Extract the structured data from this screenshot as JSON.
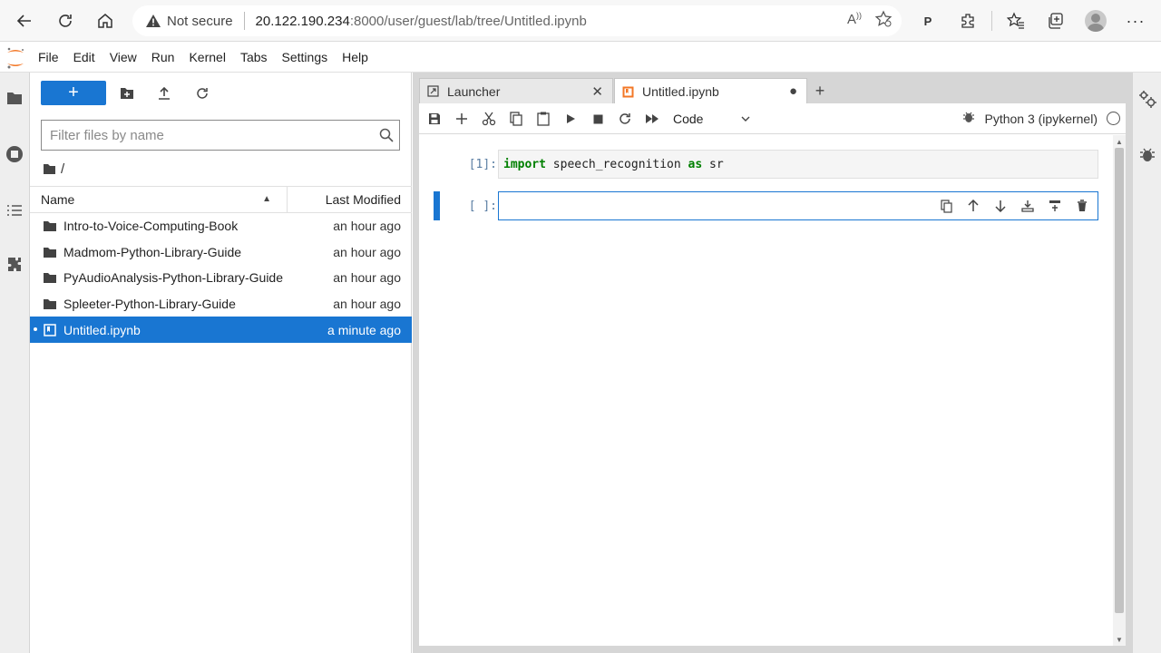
{
  "browser": {
    "security_label": "Not secure",
    "url_host": "20.122.190.234",
    "url_rest": ":8000/user/guest/lab/tree/Untitled.ipynb",
    "icons": [
      "back-icon",
      "reload-icon",
      "home-icon",
      "read-aloud-icon",
      "favorite-add-icon",
      "extension-p-icon",
      "extensions-icon",
      "favorites-icon",
      "collections-icon",
      "profile-avatar",
      "more-icon"
    ]
  },
  "menu": {
    "items": [
      "File",
      "Edit",
      "View",
      "Run",
      "Kernel",
      "Tabs",
      "Settings",
      "Help"
    ]
  },
  "filebrowser": {
    "new_label": "+",
    "filter_placeholder": "Filter files by name",
    "breadcrumb": "/",
    "col_name": "Name",
    "col_modified": "Last Modified",
    "rows": [
      {
        "name": "Intro-to-Voice-Computing-Book",
        "modified": "an hour ago",
        "type": "folder"
      },
      {
        "name": "Madmom-Python-Library-Guide",
        "modified": "an hour ago",
        "type": "folder"
      },
      {
        "name": "PyAudioAnalysis-Python-Library-Guide",
        "modified": "an hour ago",
        "type": "folder"
      },
      {
        "name": "Spleeter-Python-Library-Guide",
        "modified": "an hour ago",
        "type": "folder"
      },
      {
        "name": "Untitled.ipynb",
        "modified": "a minute ago",
        "type": "notebook",
        "selected": true
      }
    ]
  },
  "tabs": [
    {
      "label": "Launcher",
      "close": "✕"
    },
    {
      "label": "Untitled.ipynb",
      "close": "●"
    }
  ],
  "notebook": {
    "cell_type": "Code",
    "kernel_name": "Python 3 (ipykernel)",
    "cells": [
      {
        "prompt": "[1]:",
        "code_kw1": "import",
        "code_mid": " speech_recognition ",
        "code_kw2": "as",
        "code_end": " sr"
      },
      {
        "prompt": "[ ]:",
        "code": ""
      }
    ]
  },
  "colors": {
    "accent": "#1976d2",
    "keyword": "#008000",
    "prompt": "#5a7ea3",
    "jupyter_orange": "#f37726"
  }
}
